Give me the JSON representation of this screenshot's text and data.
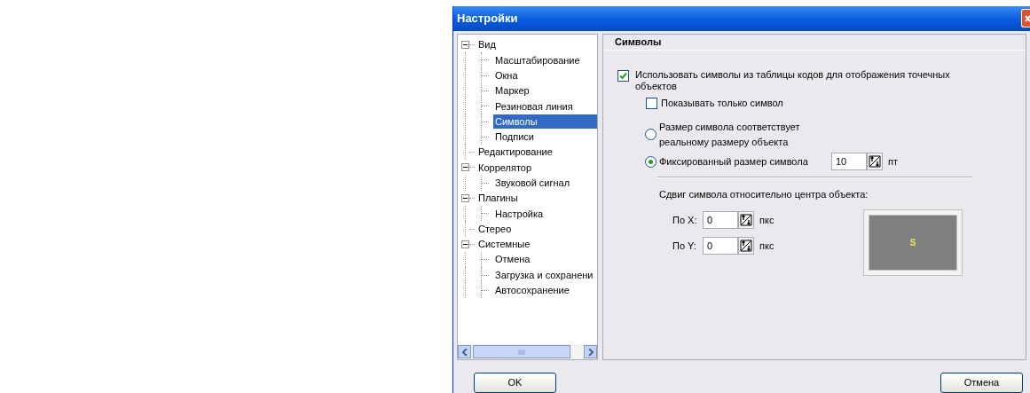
{
  "window": {
    "title": "Настройки"
  },
  "tree": {
    "items": [
      {
        "label": "Вид",
        "expanded": true,
        "selected": false,
        "children": [
          {
            "label": "Масштабирование",
            "selected": false
          },
          {
            "label": "Окна",
            "selected": false
          },
          {
            "label": "Маркер",
            "selected": false
          },
          {
            "label": "Резиновая линия",
            "selected": false
          },
          {
            "label": "Символы",
            "selected": true
          },
          {
            "label": "Подписи",
            "selected": false
          }
        ]
      },
      {
        "label": "Редактирование",
        "selected": false
      },
      {
        "label": "Коррелятор",
        "expanded": true,
        "selected": false,
        "children": [
          {
            "label": "Звуковой сигнал",
            "selected": false
          }
        ]
      },
      {
        "label": "Плагины",
        "expanded": true,
        "selected": false,
        "children": [
          {
            "label": "Настройка",
            "selected": false
          }
        ]
      },
      {
        "label": "Стерео",
        "selected": false
      },
      {
        "label": "Системные",
        "expanded": true,
        "selected": false,
        "children": [
          {
            "label": "Отмена",
            "selected": false
          },
          {
            "label": "Загрузка и сохранени",
            "selected": false
          },
          {
            "label": "Автосохранение",
            "selected": false
          }
        ]
      }
    ]
  },
  "panel": {
    "title": "Символы",
    "use_symbols": {
      "label": "Использовать символы из таблицы кодов для отображения точечных объектов",
      "checked": true
    },
    "only_symbol": {
      "label": "Показывать только символ",
      "checked": false
    },
    "size_options": [
      {
        "label": "Размер символа соответствует реальному размеру объекта",
        "selected": false
      },
      {
        "label": "Фиксированный размер символа",
        "selected": true,
        "value": "10",
        "unit": "пт"
      }
    ],
    "offset": {
      "label": "Сдвиг символа относительно центра объекта:",
      "fields": [
        {
          "label": "По X:",
          "value": "0",
          "unit": "пкс"
        },
        {
          "label": "По Y:",
          "value": "0",
          "unit": "пкс"
        }
      ]
    },
    "preview": {
      "symbol": "S"
    }
  },
  "buttons": [
    {
      "label": "OK"
    },
    {
      "label": "Отмена"
    }
  ]
}
